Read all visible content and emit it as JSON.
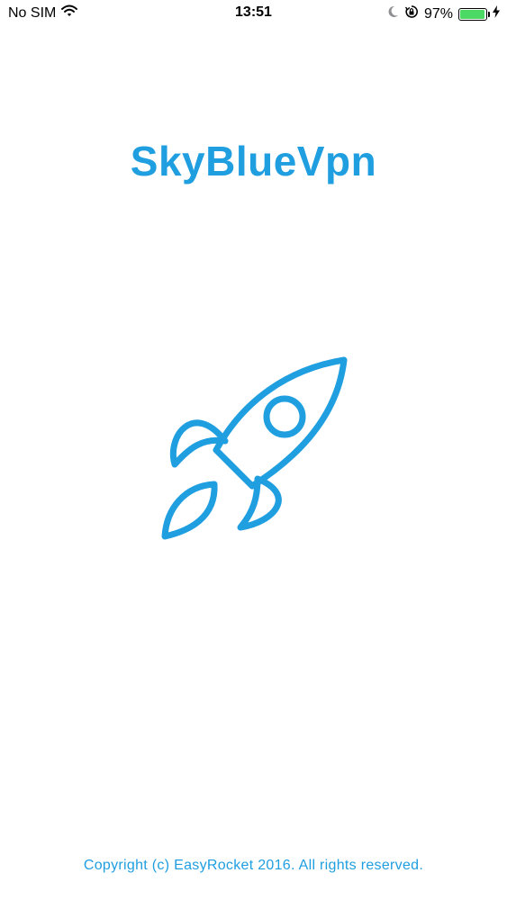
{
  "status_bar": {
    "carrier": "No SIM",
    "time": "13:51",
    "battery_percent": "97%",
    "battery_level": 0.97,
    "icons": [
      "wifi-icon",
      "do-not-disturb-moon-icon",
      "rotation-lock-icon",
      "battery-icon",
      "charging-bolt-icon"
    ]
  },
  "splash": {
    "app_title": "SkyBlueVpn",
    "logo_icon": "rocket-icon",
    "copyright": "Copyright (c) EasyRocket 2016. All rights reserved."
  },
  "colors": {
    "brand": "#1f9ee0",
    "background": "#ffffff",
    "battery_fill": "#4cd964"
  }
}
